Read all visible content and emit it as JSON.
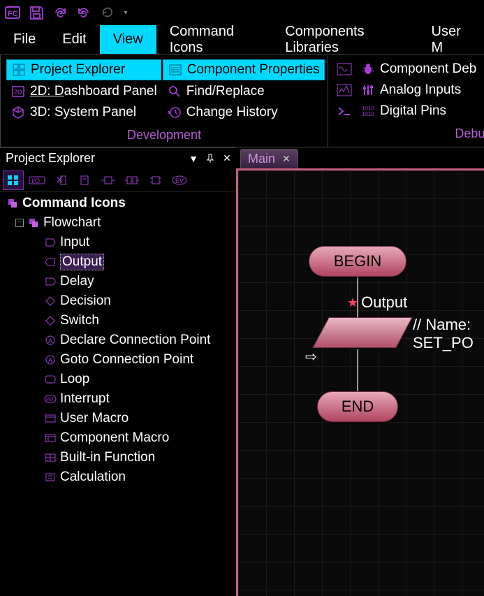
{
  "toolbar": {
    "icons": [
      "app-logo",
      "save",
      "redo",
      "undo",
      "refresh-step"
    ]
  },
  "menu": {
    "items": [
      "File",
      "Edit",
      "View",
      "Command Icons",
      "Components Libraries",
      "User M"
    ],
    "active_index": 2
  },
  "ribbon": {
    "groups": [
      {
        "label": "Development",
        "columns": [
          [
            {
              "label": "Project Explorer",
              "icon": "grid-icon",
              "highlighted": true
            },
            {
              "label": "2D: Dashboard Panel",
              "icon": "panel-2d-icon",
              "underline_prefix": "2D: ",
              "highlighted": false
            },
            {
              "label": "3D: System Panel",
              "icon": "cube-icon",
              "highlighted": false
            }
          ],
          [
            {
              "label": "Component Properties",
              "icon": "list-icon",
              "highlighted": true
            },
            {
              "label": "Find/Replace",
              "icon": "search-icon",
              "highlighted": false
            },
            {
              "label": "Change History",
              "icon": "history-icon",
              "highlighted": false
            }
          ]
        ]
      },
      {
        "label": "Debu",
        "columns": [
          [
            {
              "label": "",
              "icon": "wave-icon"
            },
            {
              "label": "",
              "icon": "scope-icon"
            },
            {
              "label": "",
              "icon": "terminal-icon"
            }
          ],
          [
            {
              "label": "Component Deb",
              "icon": "bug-icon"
            },
            {
              "label": "Analog Inputs",
              "icon": "sliders-icon"
            },
            {
              "label": "Digital Pins",
              "icon": "binary-icon"
            }
          ]
        ]
      }
    ]
  },
  "explorer": {
    "title": "Project Explorer",
    "toolbar_icons": [
      "grid-view",
      "io-view",
      "x-filter",
      "block-view",
      "hbox-view",
      "hbox2-view",
      "chip-view",
      "ev-view"
    ],
    "tree": {
      "root": {
        "label": "Command Icons",
        "icon": "stack-icon"
      },
      "group": {
        "label": "Flowchart",
        "icon": "stack-icon"
      },
      "items": [
        {
          "label": "Input",
          "icon": "input-icon"
        },
        {
          "label": "Output",
          "icon": "output-icon",
          "selected": true
        },
        {
          "label": "Delay",
          "icon": "delay-icon"
        },
        {
          "label": "Decision",
          "icon": "decision-icon"
        },
        {
          "label": "Switch",
          "icon": "switch-icon"
        },
        {
          "label": "Declare Connection Point",
          "icon": "point-a-icon"
        },
        {
          "label": "Goto Connection Point",
          "icon": "point-a-icon"
        },
        {
          "label": "Loop",
          "icon": "loop-icon"
        },
        {
          "label": "Interrupt",
          "icon": "int-icon"
        },
        {
          "label": "User Macro",
          "icon": "macro-icon"
        },
        {
          "label": "Component Macro",
          "icon": "cmacro-icon"
        },
        {
          "label": "Built-in Function",
          "icon": "func-icon"
        },
        {
          "label": "Calculation",
          "icon": "calc-icon"
        }
      ]
    }
  },
  "editor": {
    "tab": {
      "label": "Main"
    },
    "begin": "BEGIN",
    "end": "END",
    "output_label": "Output",
    "code_line1": "// Name:",
    "code_line2": "SET_PO"
  }
}
